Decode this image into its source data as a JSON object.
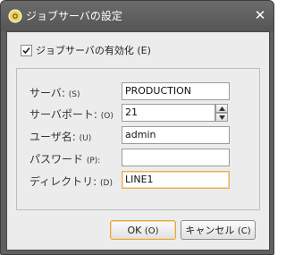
{
  "window": {
    "title": "ジョブサーバの設定",
    "icon": "app-gear-icon",
    "close_glyph": "✕"
  },
  "enable": {
    "label": "ジョブサーバの有効化 (E)",
    "checked": true
  },
  "fields": {
    "server": {
      "label": "サーバ:",
      "key": "(S)",
      "value": "PRODUCTION"
    },
    "port": {
      "label": "サーバポート:",
      "key": "(O)",
      "value": "21"
    },
    "user": {
      "label": "ユーザ名:",
      "key": "(U)",
      "value": "admin"
    },
    "password": {
      "label": "パスワード",
      "key": "(P):",
      "value": ""
    },
    "directory": {
      "label": "ディレクトリ:",
      "key": "(D)",
      "value": "LINE1"
    }
  },
  "buttons": {
    "ok": {
      "label": "OK",
      "key": "(O)"
    },
    "cancel": {
      "label": "キャンセル",
      "key": "(C)"
    }
  },
  "colors": {
    "titlebar": "#5f5f5f",
    "client": "#ececec",
    "focus_border": "#e5b15a"
  }
}
